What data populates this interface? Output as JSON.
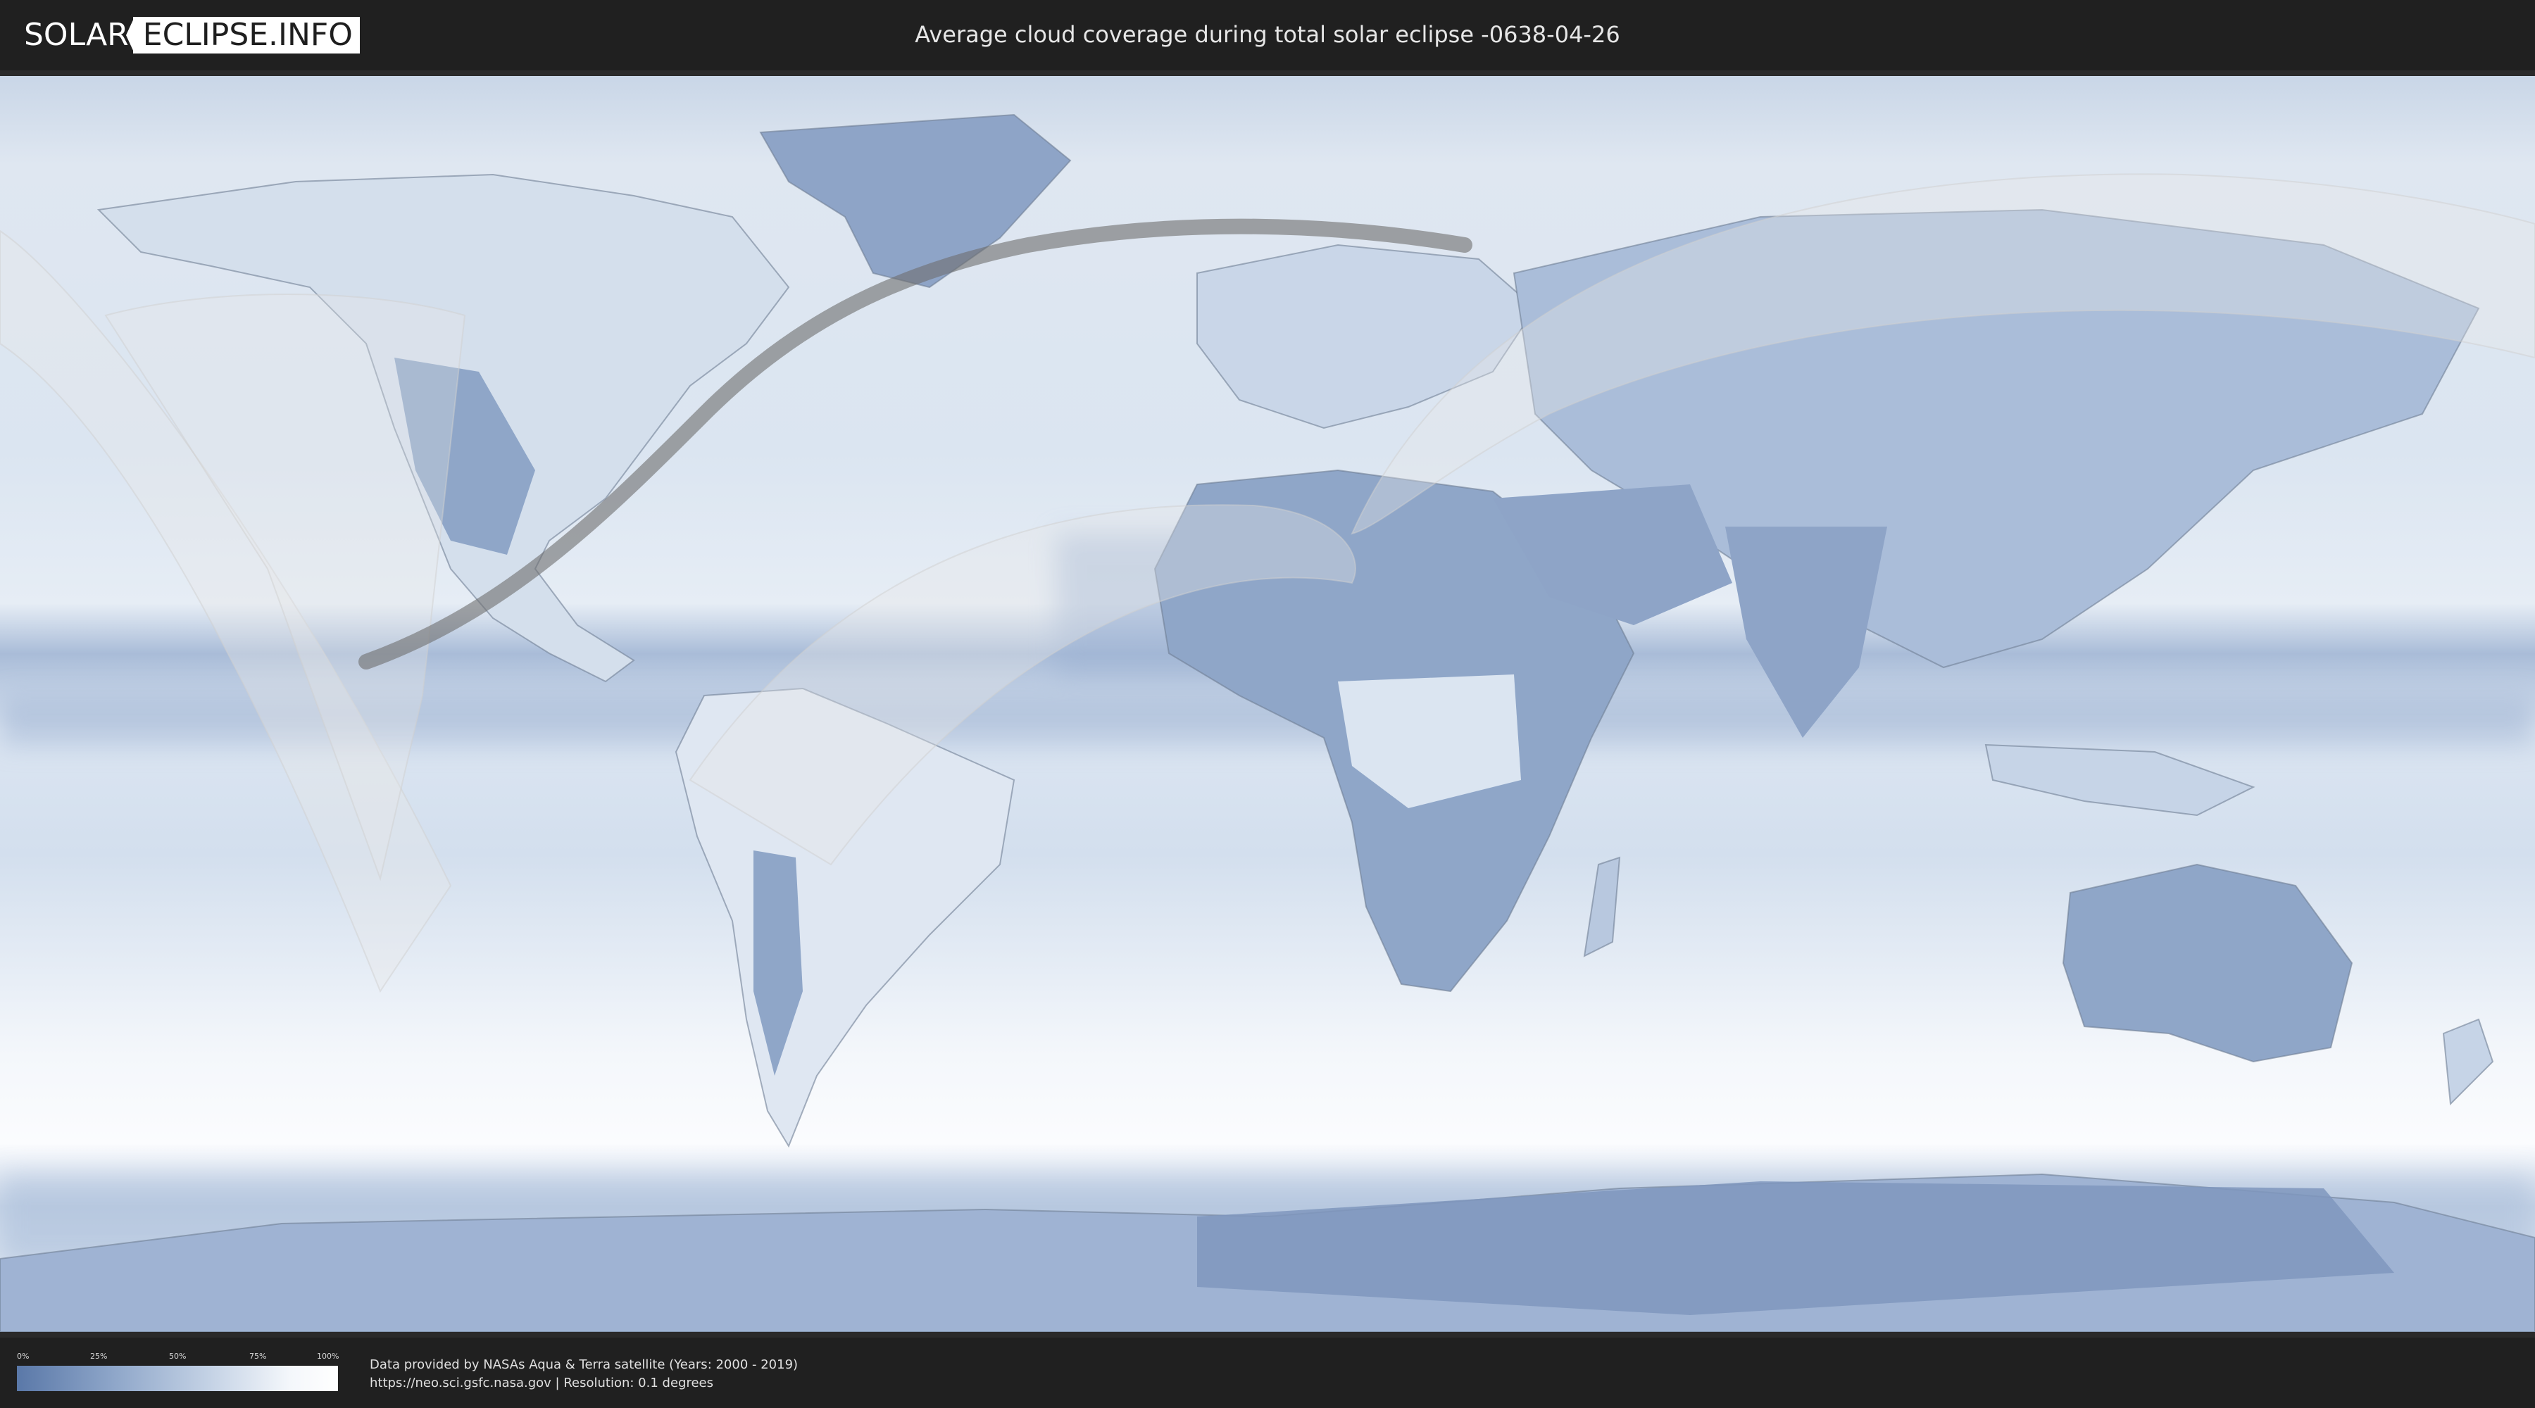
{
  "header": {
    "logo_part1": "SOLAR",
    "logo_part2": "ECLIPSE.INFO",
    "title": "Average cloud coverage during total solar eclipse -0638-04-26"
  },
  "legend": {
    "ticks": [
      "0%",
      "25%",
      "50%",
      "75%",
      "100%"
    ],
    "gradient_colors": [
      "#5a78a8",
      "#8ea6c9",
      "#c4d2e5",
      "#f4f7fb",
      "#ffffff"
    ]
  },
  "footer": {
    "credit_line1": "Data provided by NASAs Aqua & Terra satellite (Years: 2000 - 2019)",
    "credit_line2": "https://neo.sci.gsfc.nasa.gov | Resolution: 0.1 degrees"
  },
  "map": {
    "projection": "equirectangular",
    "ocean_color": "#dbe5f1",
    "land_color": "#8fa6c8",
    "eclipse_path_color": "#6e6e6e",
    "visibility_overlay_color": "#e8e8e8"
  }
}
